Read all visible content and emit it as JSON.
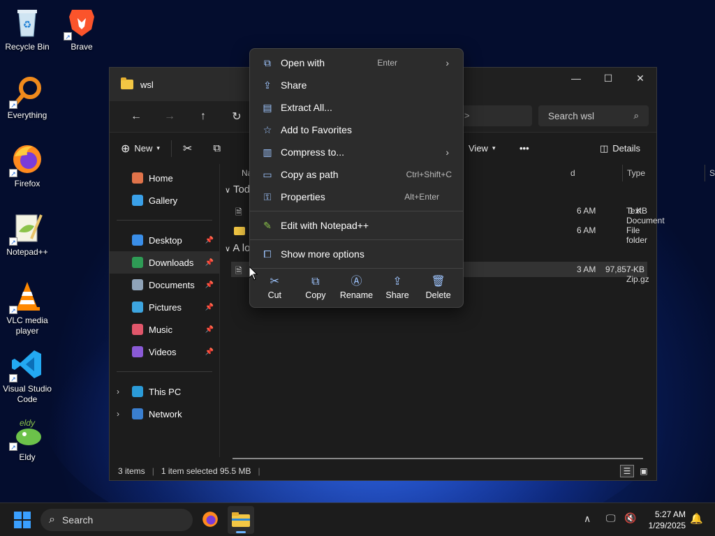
{
  "desktop": {
    "icons": [
      {
        "label": "Recycle Bin",
        "icon": "recycle-bin-icon"
      },
      {
        "label": "Brave",
        "icon": "brave-icon"
      },
      {
        "label": "Everything",
        "icon": "everything-icon"
      },
      {
        "label": "Firefox",
        "icon": "firefox-icon"
      },
      {
        "label": "Notepad++",
        "icon": "notepadpp-icon"
      },
      {
        "label": "VLC media player",
        "icon": "vlc-icon"
      },
      {
        "label": "Visual Studio Code",
        "icon": "vscode-icon"
      },
      {
        "label": "Eldy",
        "icon": "eldy-icon"
      }
    ]
  },
  "window": {
    "tab_title": "wsl",
    "search_placeholder": "Search wsl",
    "address_chevron": ">",
    "cmd": {
      "new_label": "New",
      "view_label": "View",
      "more_label": "•••",
      "details_label": "Details"
    },
    "sidebar": {
      "items": [
        {
          "label": "Home"
        },
        {
          "label": "Gallery"
        },
        {
          "label": "Desktop"
        },
        {
          "label": "Downloads"
        },
        {
          "label": "Documents"
        },
        {
          "label": "Pictures"
        },
        {
          "label": "Music"
        },
        {
          "label": "Videos"
        },
        {
          "label": "This PC"
        },
        {
          "label": "Network"
        }
      ]
    },
    "columns": {
      "name": "Na",
      "date": "d",
      "type": "Type",
      "size": "Size"
    },
    "groups": {
      "today": "Tod",
      "long_ago": "A lo"
    },
    "rows": [
      {
        "date": "6 AM",
        "type": "Text Document",
        "size": "1 KB"
      },
      {
        "date": "6 AM",
        "type": "File folder",
        "size": ""
      },
      {
        "date": "3 AM",
        "type": "7-Zip.gz",
        "size": "97,857 KB"
      }
    ],
    "status": {
      "items": "3 items",
      "selected": "1 item selected  95.5 MB"
    }
  },
  "context_menu": {
    "items": [
      {
        "label": "Open with",
        "shortcut": "Enter",
        "icon": "open-with-icon"
      },
      {
        "label": "Share",
        "shortcut": "",
        "icon": "share-icon"
      },
      {
        "label": "Extract All...",
        "shortcut": "",
        "icon": "extract-icon"
      },
      {
        "label": "Add to Favorites",
        "shortcut": "",
        "icon": "star-icon"
      },
      {
        "label": "Compress to...",
        "shortcut": "",
        "icon": "compress-icon"
      },
      {
        "label": "Copy as path",
        "shortcut": "Ctrl+Shift+C",
        "icon": "copy-path-icon"
      },
      {
        "label": "Properties",
        "shortcut": "Alt+Enter",
        "icon": "properties-icon"
      },
      {
        "label": "Edit with Notepad++",
        "shortcut": "",
        "icon": "notepadpp-icon"
      },
      {
        "label": "Show more options",
        "shortcut": "",
        "icon": "more-options-icon"
      }
    ],
    "actions": [
      {
        "label": "Cut"
      },
      {
        "label": "Copy"
      },
      {
        "label": "Rename"
      },
      {
        "label": "Share"
      },
      {
        "label": "Delete"
      }
    ]
  },
  "taskbar": {
    "search_label": "Search",
    "time": "5:27 AM",
    "date": "1/29/2025"
  }
}
